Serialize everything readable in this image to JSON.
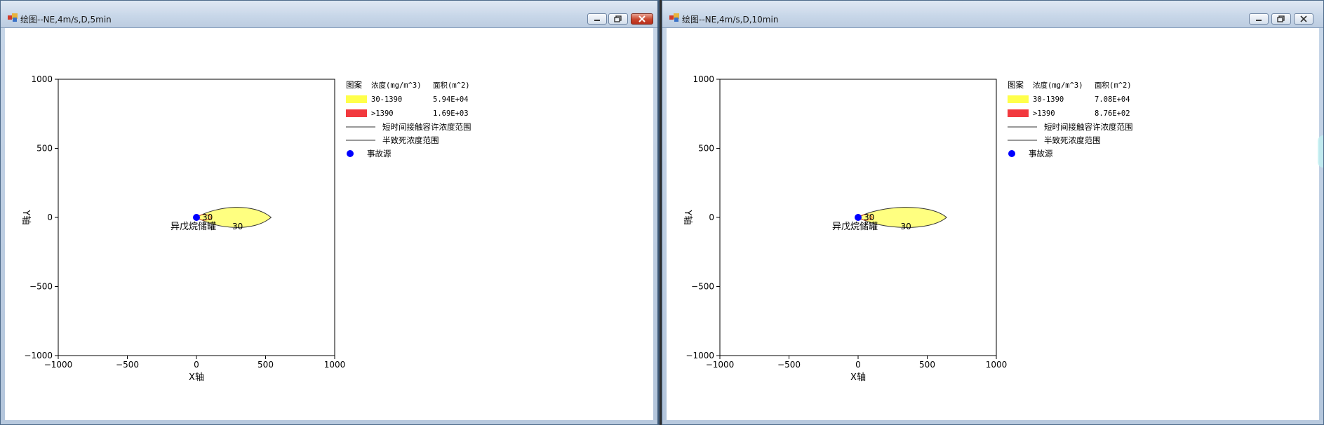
{
  "windows": [
    {
      "title": "绘图--NE,4m/s,D,5min",
      "legend": {
        "headers": [
          "图案",
          "浓度(mg/m^3)",
          "面积(m^2)"
        ],
        "rows": [
          {
            "color": "#ffff4a",
            "range": "30-1390",
            "area": "5.94E+04"
          },
          {
            "color": "#f2393e",
            "range": ">1390",
            "area": "1.69E+03"
          }
        ],
        "line_entries": [
          "短时间接触容许浓度范围",
          "半致死浓度范围"
        ],
        "source_label": "事故源",
        "source_color": "#0000ff"
      },
      "plot": {
        "xlim": [
          -1000,
          1000
        ],
        "ylim": [
          -1000,
          1000
        ],
        "xticks": [
          "-1000",
          "-500",
          "0",
          "500",
          "1000"
        ],
        "yticks": [
          "1000",
          "500",
          "0",
          "-500",
          "-1000"
        ],
        "xlabel": "X轴",
        "ylabel": "Y轴",
        "source_name": "异戊烷储罐",
        "contour_label": "30",
        "inner_label": "30",
        "plume_color": "#ffff80",
        "plume_extent_x": [
          0,
          540
        ],
        "plume_halfwidth_y": 72
      }
    },
    {
      "title": "绘图--NE,4m/s,D,10min",
      "legend": {
        "headers": [
          "图案",
          "浓度(mg/m^3)",
          "面积(m^2)"
        ],
        "rows": [
          {
            "color": "#ffff4a",
            "range": "30-1390",
            "area": "7.08E+04"
          },
          {
            "color": "#f2393e",
            "range": ">1390",
            "area": "8.76E+02"
          }
        ],
        "line_entries": [
          "短时间接触容许浓度范围",
          "半致死浓度范围"
        ],
        "source_label": "事故源",
        "source_color": "#0000ff"
      },
      "plot": {
        "xlim": [
          -1000,
          1000
        ],
        "ylim": [
          -1000,
          1000
        ],
        "xticks": [
          "-1000",
          "-500",
          "0",
          "500",
          "1000"
        ],
        "yticks": [
          "1000",
          "500",
          "0",
          "-500",
          "-1000"
        ],
        "xlabel": "X轴",
        "ylabel": "Y轴",
        "source_name": "异戊烷储罐",
        "contour_label": "30",
        "inner_label": "30",
        "plume_color": "#ffff80",
        "plume_extent_x": [
          0,
          640
        ],
        "plume_halfwidth_y": 72
      }
    }
  ]
}
